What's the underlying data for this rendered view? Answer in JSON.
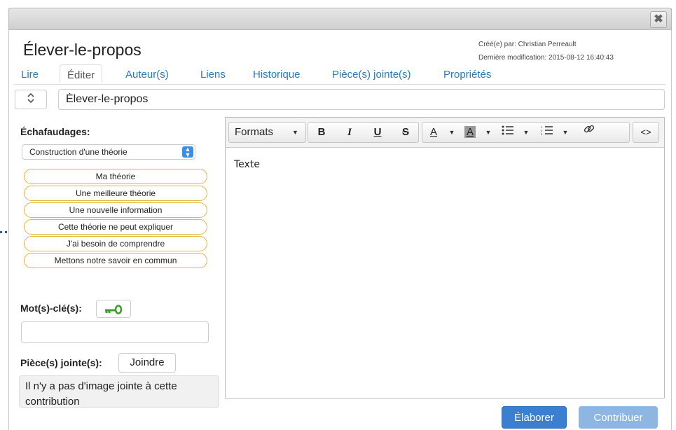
{
  "window": {
    "close_label": "✖"
  },
  "note": {
    "title": "Élever-le-propos",
    "created_by": "Créé(e) par: Christian Perreault",
    "last_modified": "Dernière modification: 2015-08-12 16:40:43",
    "title_value": "Élever-le-propos"
  },
  "tabs": [
    "Lire",
    "Éditer",
    "Auteur(s)",
    "Liens",
    "Historique",
    "Pièce(s) jointe(s)",
    "Propriétés"
  ],
  "scaffolds": {
    "label": "Échafaudages:",
    "selected": "Construction d'une théorie",
    "items": [
      "Ma théorie",
      "Une meilleure théorie",
      "Une nouvelle information",
      "Cette théorie ne peut expliquer",
      "J'ai besoin de comprendre",
      "Mettons notre savoir en commun"
    ]
  },
  "keywords": {
    "label": "Mot(s)-clé(s):",
    "value": ""
  },
  "attachments": {
    "label": "Pièce(s) jointe(s):",
    "join_label": "Joindre",
    "empty_text": "Il n'y a pas d'image jointe à cette contribution"
  },
  "editor": {
    "formats_label": "Formats",
    "bold": "B",
    "italic": "I",
    "underline": "U",
    "strike": "S",
    "text_color": "A",
    "bg_color": "A",
    "code": "<>",
    "content": "Texte"
  },
  "actions": {
    "elaborate": "Élaborer",
    "contribute": "Contribuer"
  },
  "colors": {
    "primary": "#3a7fd0",
    "disabled": "#8fb5e2",
    "scaffold_border": "#e6b23e",
    "link": "#2a7ab8",
    "key_icon": "#3aa02a"
  }
}
